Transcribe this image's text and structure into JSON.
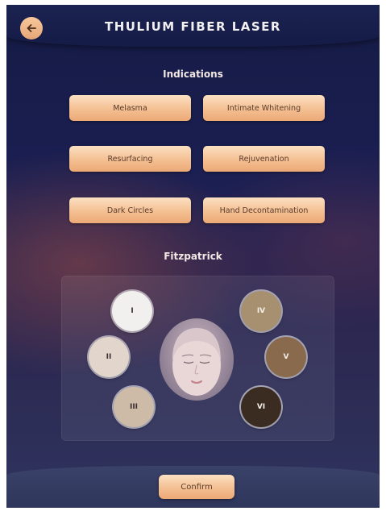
{
  "header": {
    "title": "THULIUM FIBER LASER",
    "back_icon": "arrow-left-icon"
  },
  "indications": {
    "title": "Indications",
    "items": [
      {
        "label": "Melasma"
      },
      {
        "label": "Intimate Whitening"
      },
      {
        "label": "Resurfacing"
      },
      {
        "label": "Rejuvenation"
      },
      {
        "label": "Dark Circles"
      },
      {
        "label": "Hand Decontamination"
      }
    ]
  },
  "fitzpatrick": {
    "title": "Fitzpatrick",
    "types": [
      {
        "label": "I",
        "color": "#f2efef",
        "text_color": "#3a3030"
      },
      {
        "label": "II",
        "color": "#e2d6cc",
        "text_color": "#3a3030"
      },
      {
        "label": "III",
        "color": "#cdbba8",
        "text_color": "#3a3030"
      },
      {
        "label": "IV",
        "color": "#a7906f",
        "text_color": "#f5efe8"
      },
      {
        "label": "V",
        "color": "#8a6a4c",
        "text_color": "#f5efe8"
      },
      {
        "label": "VI",
        "color": "#3b2c22",
        "text_color": "#f5efe8"
      }
    ],
    "face_icon": "face-icon"
  },
  "footer": {
    "confirm_label": "Confirm"
  }
}
